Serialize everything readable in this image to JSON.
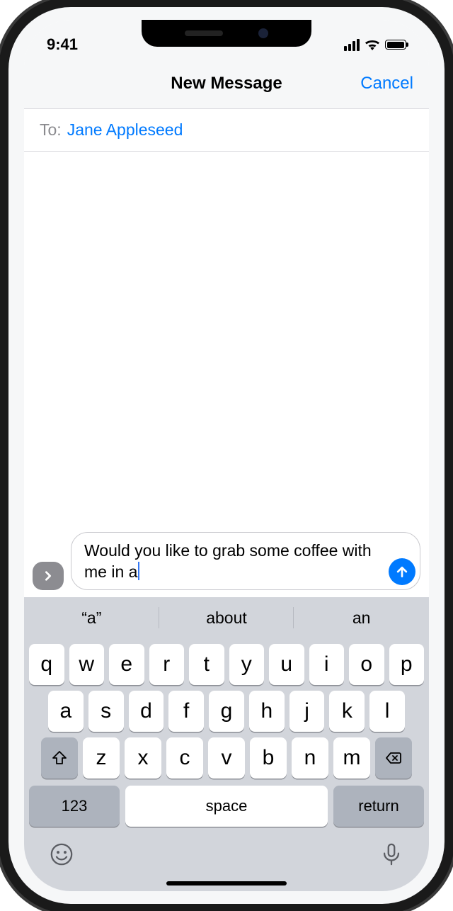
{
  "status": {
    "time": "9:41"
  },
  "nav": {
    "title": "New Message",
    "cancel": "Cancel"
  },
  "to": {
    "label": "To:",
    "recipient": "Jane Appleseed"
  },
  "compose": {
    "text": "Would you like to grab some coffee with me in a"
  },
  "suggestions": [
    "“a”",
    "about",
    "an"
  ],
  "keyboard": {
    "row1": [
      "q",
      "w",
      "e",
      "r",
      "t",
      "y",
      "u",
      "i",
      "o",
      "p"
    ],
    "row2": [
      "a",
      "s",
      "d",
      "f",
      "g",
      "h",
      "j",
      "k",
      "l"
    ],
    "row3": [
      "z",
      "x",
      "c",
      "v",
      "b",
      "n",
      "m"
    ],
    "numbers_label": "123",
    "space_label": "space",
    "return_label": "return"
  }
}
